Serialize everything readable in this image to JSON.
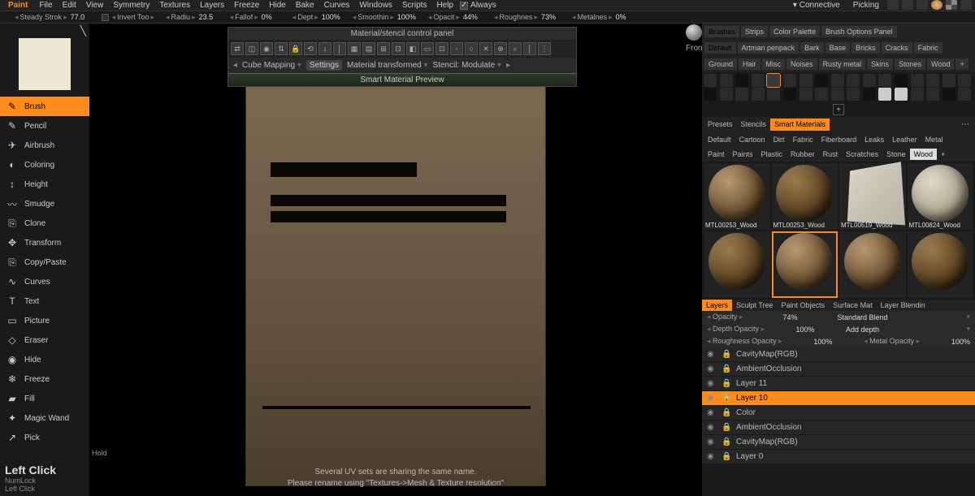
{
  "app": "Paint",
  "menu": [
    "File",
    "Edit",
    "View",
    "Symmetry",
    "Textures",
    "Layers",
    "Freeze",
    "Hide",
    "Bake",
    "Curves",
    "Windows",
    "Scripts",
    "Help"
  ],
  "menu_check": {
    "label": "Always",
    "checked": true
  },
  "menu_right": [
    "Connective",
    "Picking"
  ],
  "toolbar": [
    {
      "label": "Steady Strok",
      "value": "77.0"
    },
    {
      "label": "Invert Too",
      "check": true
    },
    {
      "label": "Radiu",
      "value": "23.5"
    },
    {
      "label": "Fallof",
      "value": "0%"
    },
    {
      "label": "Dept",
      "value": "100%"
    },
    {
      "label": "Smoothin",
      "value": "100%"
    },
    {
      "label": "Opacit",
      "value": "44%"
    },
    {
      "label": "Roughnes",
      "value": "73%"
    },
    {
      "label": "Metalnes",
      "value": "0%"
    }
  ],
  "tools": [
    {
      "icon": "✎",
      "label": "Brush",
      "active": true
    },
    {
      "icon": "✎",
      "label": "Pencil"
    },
    {
      "icon": "✈",
      "label": "Airbrush"
    },
    {
      "icon": "◐",
      "label": "Coloring"
    },
    {
      "icon": "↕",
      "label": "Height"
    },
    {
      "icon": "〰",
      "label": "Smudge"
    },
    {
      "icon": "⎘",
      "label": "Clone"
    },
    {
      "icon": "✥",
      "label": "Transform"
    },
    {
      "icon": "⎘",
      "label": "Copy/Paste"
    },
    {
      "icon": "∿",
      "label": "Curves"
    },
    {
      "icon": "T",
      "label": "Text"
    },
    {
      "icon": "▭",
      "label": "Picture"
    },
    {
      "icon": "◇",
      "label": "Eraser"
    },
    {
      "icon": "◉",
      "label": "Hide"
    },
    {
      "icon": "❄",
      "label": "Freeze"
    },
    {
      "icon": "▰",
      "label": "Fill"
    },
    {
      "icon": "✦",
      "label": "Magic Wand"
    },
    {
      "icon": "↗",
      "label": "Pick"
    }
  ],
  "status": {
    "big": "Left Click",
    "lines": [
      "NumLock",
      "Left Click",
      ""
    ]
  },
  "float": {
    "title": "Material/stencil control panel",
    "cube": "Cube Mapping",
    "settings": "Settings",
    "mat": "Material transformed",
    "stencil": "Stencil: Modulate",
    "smat": "Smart Material Preview"
  },
  "vp": {
    "hold": "Hold",
    "msg1": "Several UV sets are sharing the same name.",
    "msg2": "Please rename using \"Textures->Mesh & Texture resolution\""
  },
  "viewlabel": "Front",
  "rtop1": [
    "Brushes",
    "Strips",
    "Color Palette",
    "Brush Options Panel"
  ],
  "rtop1sel": 0,
  "rtop2": [
    "Default",
    "Artman penpack",
    "Bark",
    "Base",
    "Bricks",
    "Cracks",
    "Fabric"
  ],
  "rtop2sel": 0,
  "rtop3": [
    "Ground",
    "Hair",
    "Misc",
    "Noises",
    "Rusty metal",
    "Skins",
    "Stones",
    "Wood",
    "+"
  ],
  "presets": [
    "Presets",
    "Stencils",
    "Smart Materials"
  ],
  "presetsel": 2,
  "cats1": [
    "Default",
    "Cartoon",
    "Dirt",
    "Fabric",
    "Fiberboard",
    "Leaks",
    "Leather",
    "Metal"
  ],
  "cats2": [
    "Paint",
    "Paints",
    "Plastic",
    "Rubber",
    "Rust",
    "Scratches",
    "Stone",
    "Wood",
    "+"
  ],
  "catsel": "Wood",
  "mats": [
    {
      "label": "MTL00253_Wood"
    },
    {
      "label": "MTL00253_Wood"
    },
    {
      "label": "MTL00519_Wood",
      "cube": true
    },
    {
      "label": "MTL00824_Wood"
    },
    {
      "label": ""
    },
    {
      "label": "",
      "sel": true
    },
    {
      "label": ""
    },
    {
      "label": ""
    }
  ],
  "layertabs": [
    "Layers",
    "Sculpt Tree",
    "Paint Objects",
    "Surface Mat",
    "Layer Blendin"
  ],
  "layertabsel": 0,
  "props": [
    {
      "l": "Opacity",
      "v": "74%",
      "r": "Standard Blend"
    },
    {
      "l": "Depth Opacity",
      "v": "100%",
      "r": "Add depth"
    },
    {
      "l": "Roughness Opacity",
      "v": "100%",
      "r": "Metal Opacity",
      "rv": "100%"
    }
  ],
  "layers": [
    {
      "name": "CavityMap(RGB)"
    },
    {
      "name": "AmbientOcclusion"
    },
    {
      "name": "Layer 11"
    },
    {
      "name": "Layer 10",
      "sel": true
    },
    {
      "name": "Color"
    },
    {
      "name": "AmbientOcclusion"
    },
    {
      "name": "CavityMap(RGB)"
    },
    {
      "name": "Layer 0"
    }
  ]
}
